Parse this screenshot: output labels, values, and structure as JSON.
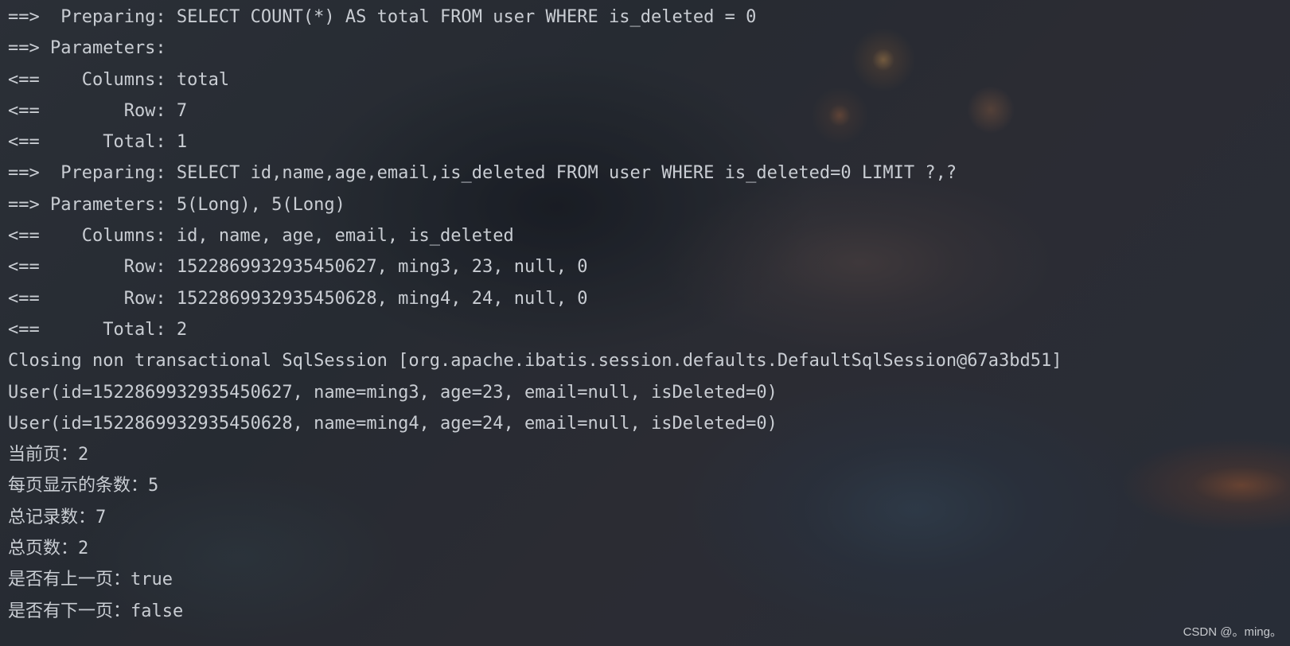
{
  "console": {
    "lines": [
      "==>  Preparing: SELECT COUNT(*) AS total FROM user WHERE is_deleted = 0",
      "==> Parameters: ",
      "<==    Columns: total",
      "<==        Row: 7",
      "<==      Total: 1",
      "==>  Preparing: SELECT id,name,age,email,is_deleted FROM user WHERE is_deleted=0 LIMIT ?,?",
      "==> Parameters: 5(Long), 5(Long)",
      "<==    Columns: id, name, age, email, is_deleted",
      "<==        Row: 1522869932935450627, ming3, 23, null, 0",
      "<==        Row: 1522869932935450628, ming4, 24, null, 0",
      "<==      Total: 2",
      "Closing non transactional SqlSession [org.apache.ibatis.session.defaults.DefaultSqlSession@67a3bd51]",
      "User(id=1522869932935450627, name=ming3, age=23, email=null, isDeleted=0)",
      "User(id=1522869932935450628, name=ming4, age=24, email=null, isDeleted=0)",
      "当前页：2",
      "每页显示的条数：5",
      "总记录数：7",
      "总页数：2",
      "是否有上一页：true",
      "是否有下一页：false"
    ]
  },
  "watermark": "CSDN @。ming。",
  "colors": {
    "text": "#c9cdd3",
    "background": "#2a2e36"
  }
}
